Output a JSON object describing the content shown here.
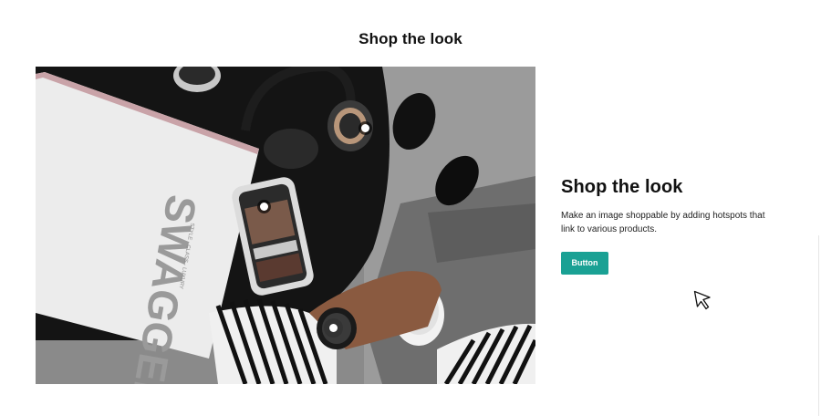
{
  "section": {
    "title": "Shop the look"
  },
  "image": {
    "alt_magazine_title": "SWAGGER",
    "alt_magazine_tagline": "STYLE · CLASS · LUXURY",
    "hotspots": [
      "hotspot-headphones",
      "hotspot-phone",
      "hotspot-watch"
    ]
  },
  "panel": {
    "title": "Shop the look",
    "description": "Make an image shoppable by adding hotspots that link to various products.",
    "button_label": "Button"
  },
  "colors": {
    "button": "#1aa194",
    "background": "#ffffff"
  },
  "icons": {
    "cursor": "pointer-cursor-icon"
  }
}
